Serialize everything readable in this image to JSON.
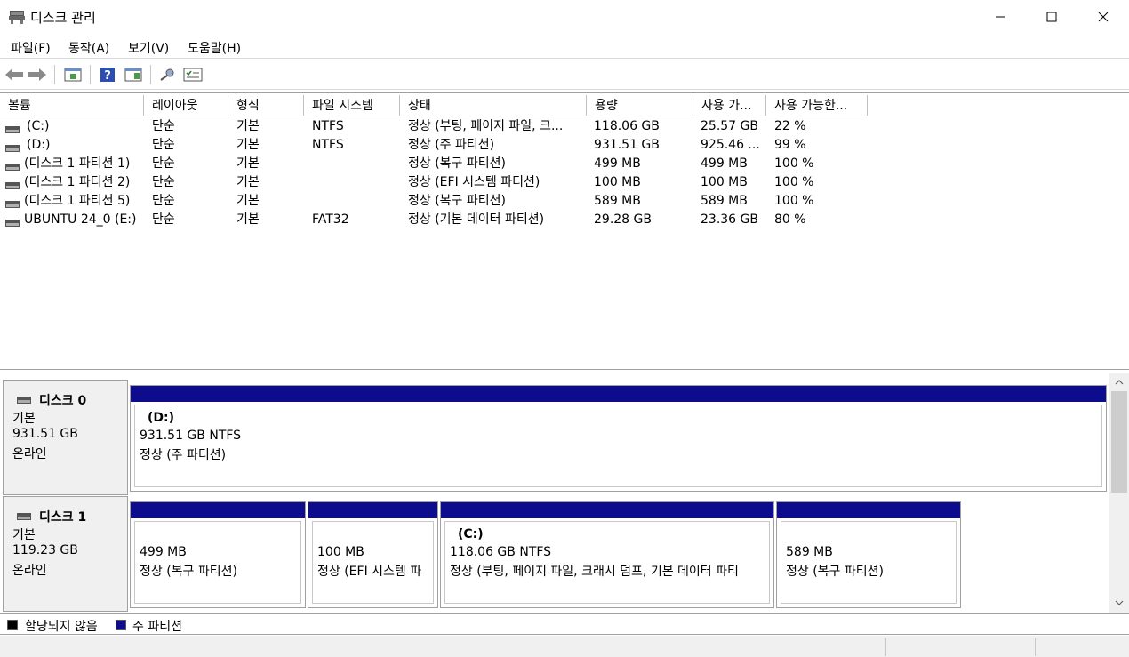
{
  "window": {
    "title": "디스크 관리"
  },
  "menu": [
    "파일(F)",
    "동작(A)",
    "보기(V)",
    "도움말(H)"
  ],
  "toolbar": [
    "back-icon",
    "forward-icon",
    "console-view-icon",
    "help-icon",
    "action-pane-icon",
    "search-icon",
    "properties-icon"
  ],
  "columns": [
    "볼륨",
    "레이아웃",
    "형식",
    "파일 시스템",
    "상태",
    "용량",
    "사용 가...",
    "사용 가능한..."
  ],
  "volumes": [
    {
      "name": "(C:)",
      "layout": "단순",
      "type": "기본",
      "fs": "NTFS",
      "status": "정상 (부팅, 페이지 파일, 크...",
      "capacity": "118.06 GB",
      "free": "25.57 GB",
      "pct": "22 %"
    },
    {
      "name": "(D:)",
      "layout": "단순",
      "type": "기본",
      "fs": "NTFS",
      "status": "정상 (주 파티션)",
      "capacity": "931.51 GB",
      "free": "925.46 ...",
      "pct": "99 %"
    },
    {
      "name": "(디스크 1 파티션 1)",
      "layout": "단순",
      "type": "기본",
      "fs": "",
      "status": "정상 (복구 파티션)",
      "capacity": "499 MB",
      "free": "499 MB",
      "pct": "100 %"
    },
    {
      "name": "(디스크 1 파티션 2)",
      "layout": "단순",
      "type": "기본",
      "fs": "",
      "status": "정상 (EFI 시스템 파티션)",
      "capacity": "100 MB",
      "free": "100 MB",
      "pct": "100 %"
    },
    {
      "name": "(디스크 1 파티션 5)",
      "layout": "단순",
      "type": "기본",
      "fs": "",
      "status": "정상 (복구 파티션)",
      "capacity": "589 MB",
      "free": "589 MB",
      "pct": "100 %"
    },
    {
      "name": "UBUNTU 24_0 (E:)",
      "layout": "단순",
      "type": "기본",
      "fs": "FAT32",
      "status": "정상 (기본 데이터 파티션)",
      "capacity": "29.28 GB",
      "free": "23.36 GB",
      "pct": "80 %"
    }
  ],
  "disks": [
    {
      "title": "디스크 0",
      "kind": "기본",
      "size": "931.51 GB",
      "state": "온라인",
      "partitions": [
        {
          "name": "(D:)",
          "size": "931.51 GB NTFS",
          "status": "정상 (주 파티션)"
        }
      ]
    },
    {
      "title": "디스크 1",
      "kind": "기본",
      "size": "119.23 GB",
      "state": "온라인",
      "partitions": [
        {
          "name": "",
          "size": "499 MB",
          "status": "정상 (복구 파티션)"
        },
        {
          "name": "",
          "size": "100 MB",
          "status": "정상 (EFI 시스템 파"
        },
        {
          "name": "(C:)",
          "size": "118.06 GB NTFS",
          "status": "정상 (부팅, 페이지 파일, 크래시 덤프, 기본 데이터 파티"
        },
        {
          "name": "",
          "size": "589 MB",
          "status": "정상 (복구 파티션)"
        }
      ]
    }
  ],
  "legend": [
    {
      "label": "할당되지 않음",
      "color": "#000000"
    },
    {
      "label": "주 파티션",
      "color": "#0c0c8c"
    }
  ]
}
